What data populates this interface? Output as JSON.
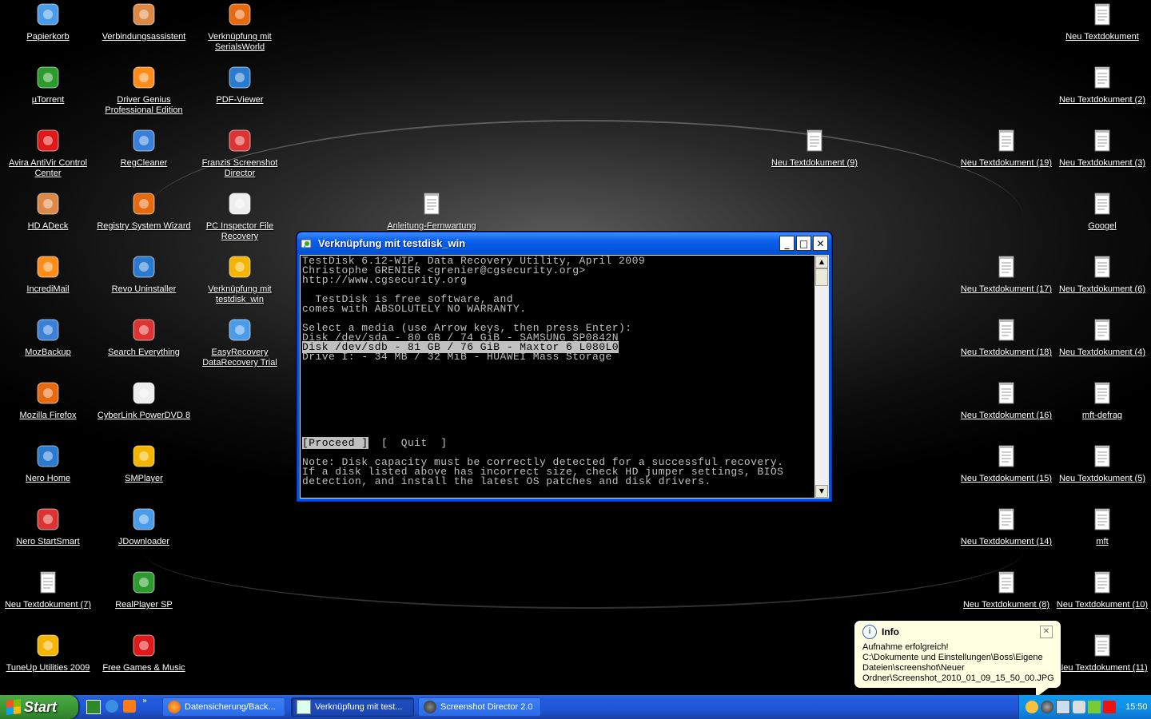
{
  "desktop": {
    "col1": [
      "Papierkorb",
      "µTorrent",
      "Avira AntiVir Control Center",
      "HD ADeck",
      "IncrediMail",
      "MozBackup",
      "Mozilla Firefox",
      "Nero Home",
      "Nero StartSmart",
      "Neu Textdokument (7)",
      "TuneUp Utilities 2009"
    ],
    "col2": [
      "Verbindungsassistent",
      "Driver Genius Professional Edition",
      "RegCleaner",
      "Registry System Wizard",
      "Revo Uninstaller",
      "Search Everything",
      "CyberLink PowerDVD 8",
      "SMPlayer",
      "JDownloader",
      "RealPlayer SP",
      "Free Games & Music"
    ],
    "col3": [
      "Verknüpfung mit SerialsWorld",
      "PDF-Viewer",
      "Franzis Screenshot Director",
      "PC Inspector File Recovery",
      "Verknüpfung mit testdisk_win",
      "EasyRecovery DataRecovery Trial"
    ],
    "mid": [
      "Anleitung-Fernwartung",
      "Neu Textdokument (9)"
    ],
    "colR1": [
      "Neu Textdokument (19)",
      "Neu Textdokument (17)",
      "Neu Textdokument (18)",
      "Neu Textdokument (16)",
      "Neu Textdokument (15)",
      "Neu Textdokument (14)",
      "Neu Textdokument (8)"
    ],
    "colR2": [
      "Neu Textdokument",
      "Neu Textdokument (2)",
      "Neu Textdokument (3)",
      "Googel",
      "Neu Textdokument (6)",
      "Neu Textdokument (4)",
      "mft-defrag",
      "Neu Textdokument (5)",
      "mft",
      "Neu Textdokument (10)",
      "Neu Textdokument (11)"
    ]
  },
  "window": {
    "title": "Verknüpfung mit testdisk_win",
    "minimize": "_",
    "maximize": "□",
    "close": "✕",
    "console": {
      "line1": "TestDisk 6.12-WIP, Data Recovery Utility, April 2009",
      "line2": "Christophe GRENIER <grenier@cgsecurity.org>",
      "line3": "http://www.cgsecurity.org",
      "line4": "",
      "line5": "  TestDisk is free software, and",
      "line6": "comes with ABSOLUTELY NO WARRANTY.",
      "line7": "",
      "line8": "Select a media (use Arrow keys, then press Enter):",
      "disk1": "Disk /dev/sda - 80 GB / 74 GiB - SAMSUNG SP0842N",
      "disk2": "Disk /dev/sdb - 81 GB / 76 GiB - Maxtor 6 L080L0",
      "disk3": "Drive I: - 34 MB / 32 MiB - HUAWEI Mass Storage",
      "proceed": "[Proceed ]",
      "quit": "[  Quit  ]",
      "note1": "Note: Disk capacity must be correctly detected for a successful recovery.",
      "note2": "If a disk listed above has incorrect size, check HD jumper settings, BIOS",
      "note3": "detection, and install the latest OS patches and disk drivers."
    }
  },
  "balloon": {
    "title": "Info",
    "close": "✕",
    "line1": "Aufnahme erfolgreich!",
    "line2": "C:\\Dokumente und Einstellungen\\Boss\\Eigene",
    "line3": "Dateien\\screenshot\\Neuer",
    "line4": "Ordner\\Screenshot_2010_01_09_15_50_00.JPG"
  },
  "taskbar": {
    "start": "Start",
    "more": "»",
    "tasks": [
      "Datensicherung/Back...",
      "Verknüpfung mit test...",
      "Screenshot Director 2.0"
    ],
    "clock": "15:50"
  },
  "colors": {
    "accent": "#0054e3",
    "start": "#3c9a36",
    "tray": "#1190e8"
  }
}
